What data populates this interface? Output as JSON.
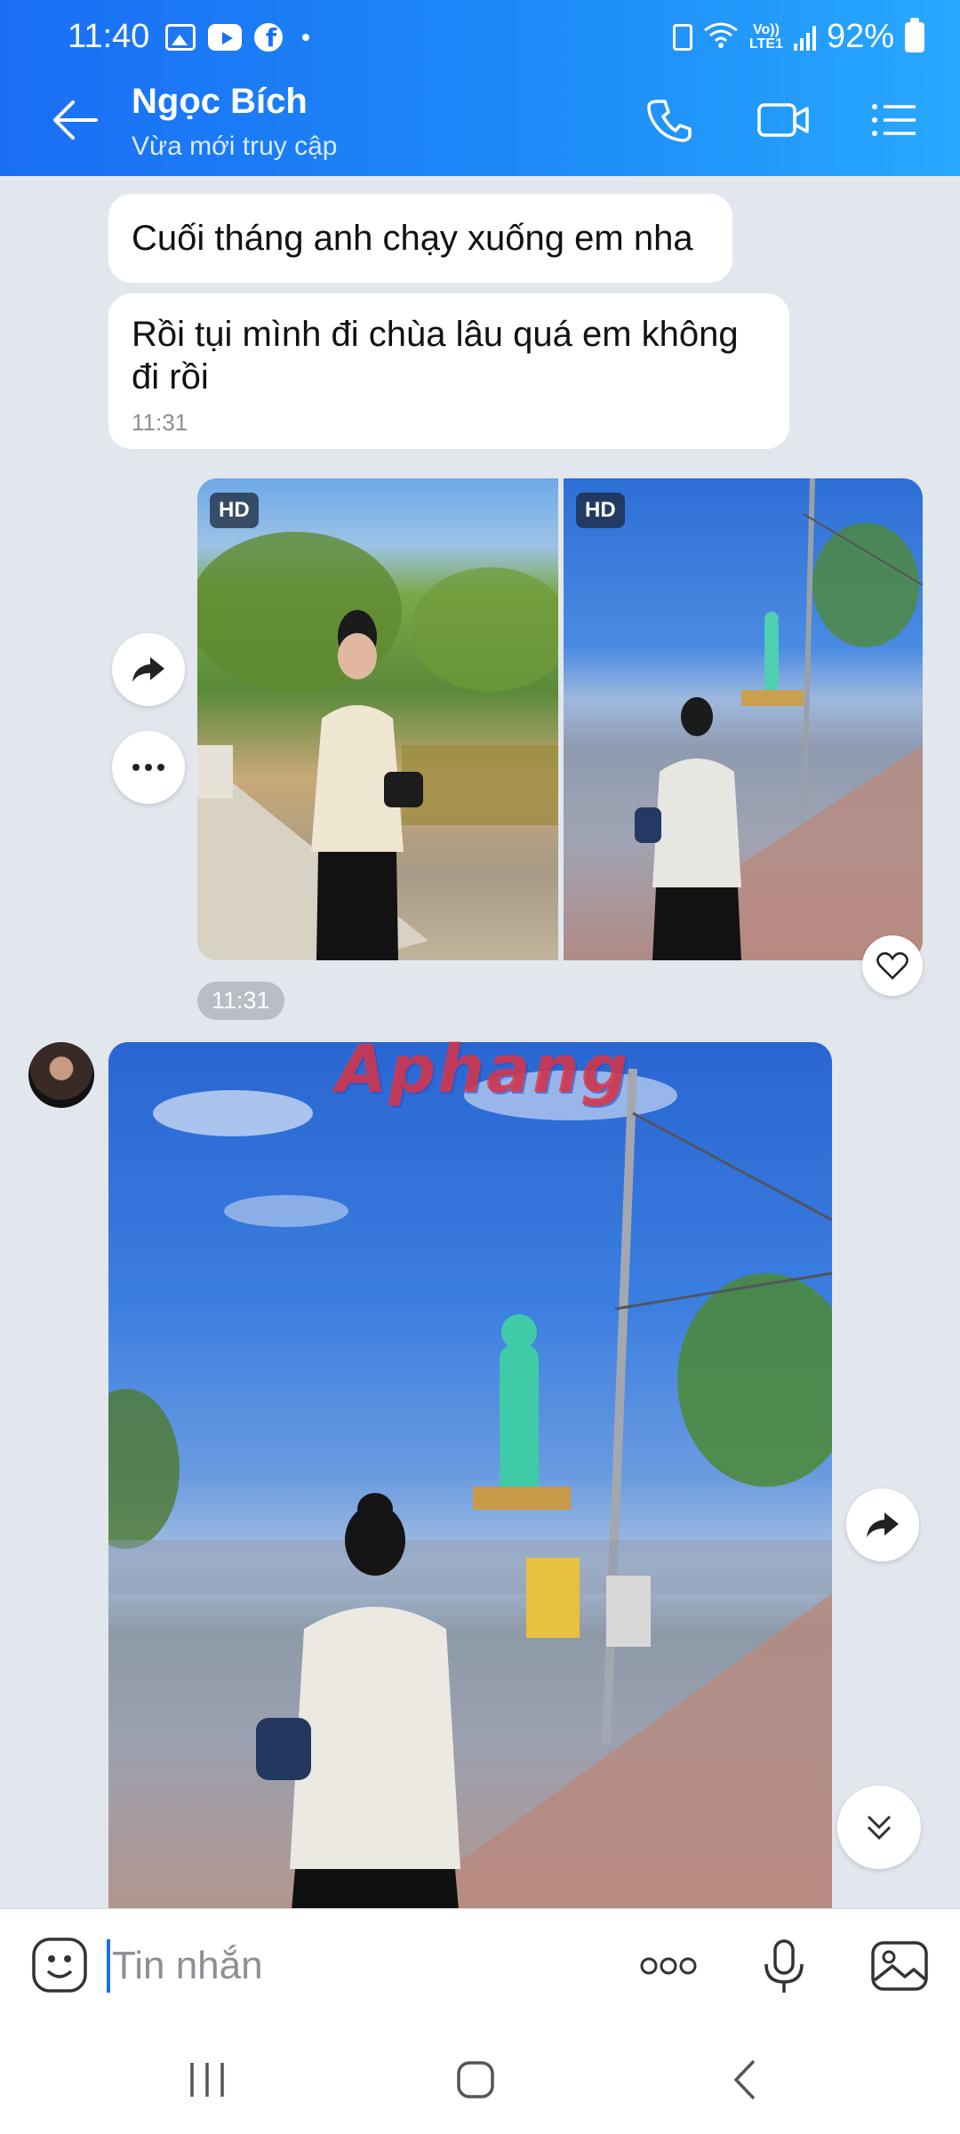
{
  "status_bar": {
    "time": "11:40",
    "battery": "92%",
    "network": "LTE1",
    "volte": "Vo))"
  },
  "header": {
    "contact_name": "Ngọc Bích",
    "last_seen": "Vừa mới truy cập"
  },
  "messages": [
    {
      "side": "incoming",
      "text": "Cuối tháng anh chạy xuống em nha"
    },
    {
      "side": "incoming",
      "text": "Rồi tụi mình đi chùa lâu quá em không đi rồi",
      "time": "11:31"
    }
  ],
  "outgoing_photos": {
    "badges": [
      "HD",
      "HD"
    ],
    "time": "11:31"
  },
  "watermark": "Aphang",
  "input": {
    "placeholder": "Tin nhắn"
  },
  "icons": {
    "back": "arrow-left-icon",
    "call": "phone-icon",
    "video": "video-camera-icon",
    "menu": "list-menu-icon",
    "forward": "share-forward-icon",
    "more": "more-horizontal-icon",
    "like": "heart-icon",
    "scroll_down": "chevron-double-down-icon",
    "emoji": "emoji-icon",
    "mic": "microphone-icon",
    "gallery": "image-icon"
  },
  "colors": {
    "header_gradient_start": "#1a6ef5",
    "header_gradient_end": "#27a8ff",
    "chat_background": "#e2e7ee",
    "accent": "#1a6ef5"
  }
}
